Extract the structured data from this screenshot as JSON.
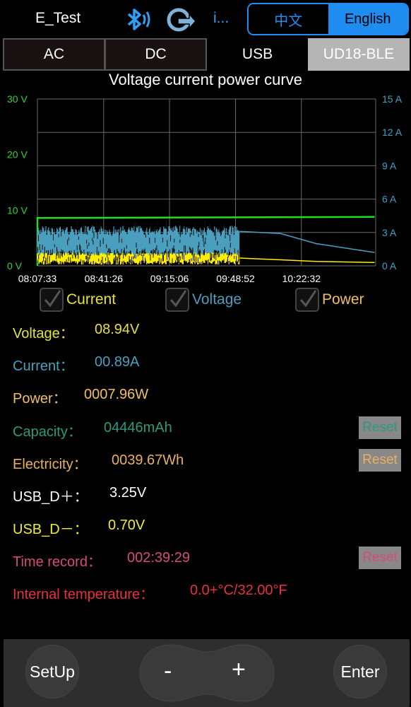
{
  "header": {
    "title": "E_Test",
    "info": "i...",
    "lang_zh": "中文",
    "lang_en": "English"
  },
  "tabs": [
    "AC",
    "DC",
    "USB",
    "UD18-BLE"
  ],
  "colors": {
    "voltage": "#e6e23a",
    "current": "#4a9fbf",
    "power": "#f0c060",
    "capacity": "#2a9a80",
    "electricity": "#e8b060",
    "usb_dp": "#ffffff",
    "usb_dm": "#f0ec30",
    "time": "#d84a7a",
    "temp": "#e83040",
    "accent": "#1e8cf0",
    "grid": "#6a6a6a",
    "left_axis": "#2fd22f",
    "right_axis": "#3aa3c8"
  },
  "chart_data": {
    "type": "line",
    "title": "Voltage current power curve",
    "y_left_ticks": [
      "30 V",
      "20 V",
      "10 V",
      "0 V"
    ],
    "y_left_range": [
      0,
      30
    ],
    "y_right_ticks": [
      "15 A",
      "12 A",
      "9 A",
      "6 A",
      "3 A",
      "0 A"
    ],
    "y_right_range": [
      0,
      15
    ],
    "x_ticks": [
      "08:07:33",
      "08:41:26",
      "09:15:06",
      "09:48:52",
      "10:22:32"
    ],
    "grid": true,
    "series": [
      {
        "name": "Voltage",
        "axis": "left",
        "points": [
          [
            "08:07:33",
            0
          ],
          [
            "08:07:33",
            8.6
          ],
          [
            "11:00:00",
            8.8
          ]
        ]
      },
      {
        "name": "Current",
        "axis": "right",
        "noisy_until": "09:51:00",
        "noise_range_a": [
          0.3,
          3.6
        ],
        "points": [
          [
            "08:07:33",
            3.2
          ],
          [
            "09:51:00",
            3.1
          ],
          [
            "10:12:00",
            2.9
          ],
          [
            "10:30:00",
            2.0
          ],
          [
            "11:00:00",
            1.2
          ]
        ]
      },
      {
        "name": "Power",
        "axis": "right",
        "noisy_until": "09:51:00",
        "noise_range_a": [
          0.1,
          1.2
        ],
        "points": [
          [
            "08:07:33",
            0.6
          ],
          [
            "09:51:00",
            0.7
          ],
          [
            "10:30:00",
            0.4
          ],
          [
            "11:00:00",
            0.3
          ]
        ]
      }
    ]
  },
  "legend": [
    {
      "label": "Current",
      "color": "#e6e23a",
      "checked": true
    },
    {
      "label": "Voltage",
      "color": "#4a9fbf",
      "checked": true
    },
    {
      "label": "Power",
      "color": "#f0c060",
      "checked": true
    }
  ],
  "readings": {
    "voltage_label": "Voltage：",
    "voltage_value": "08.94V",
    "current_label": "Current：",
    "current_value": "00.89A",
    "power_label": "Power：",
    "power_value": "0007.96W",
    "capacity_label": "Capacity：",
    "capacity_value": "04446mAh",
    "electricity_label": "Electricity：",
    "electricity_value": "0039.67Wh",
    "usb_dp_label": "USB_D＋：",
    "usb_dp_value": "3.25V",
    "usb_dm_label": "USB_D－：",
    "usb_dm_value": "0.70V",
    "time_label": "Time record：",
    "time_value": "002:39:29",
    "temp_label": "Internal temperature：",
    "temp_value": "0.0+°C/32.00°F",
    "reset": "Reset"
  },
  "controls": {
    "setup": "SetUp",
    "minus": "-",
    "plus": "+",
    "enter": "Enter"
  }
}
